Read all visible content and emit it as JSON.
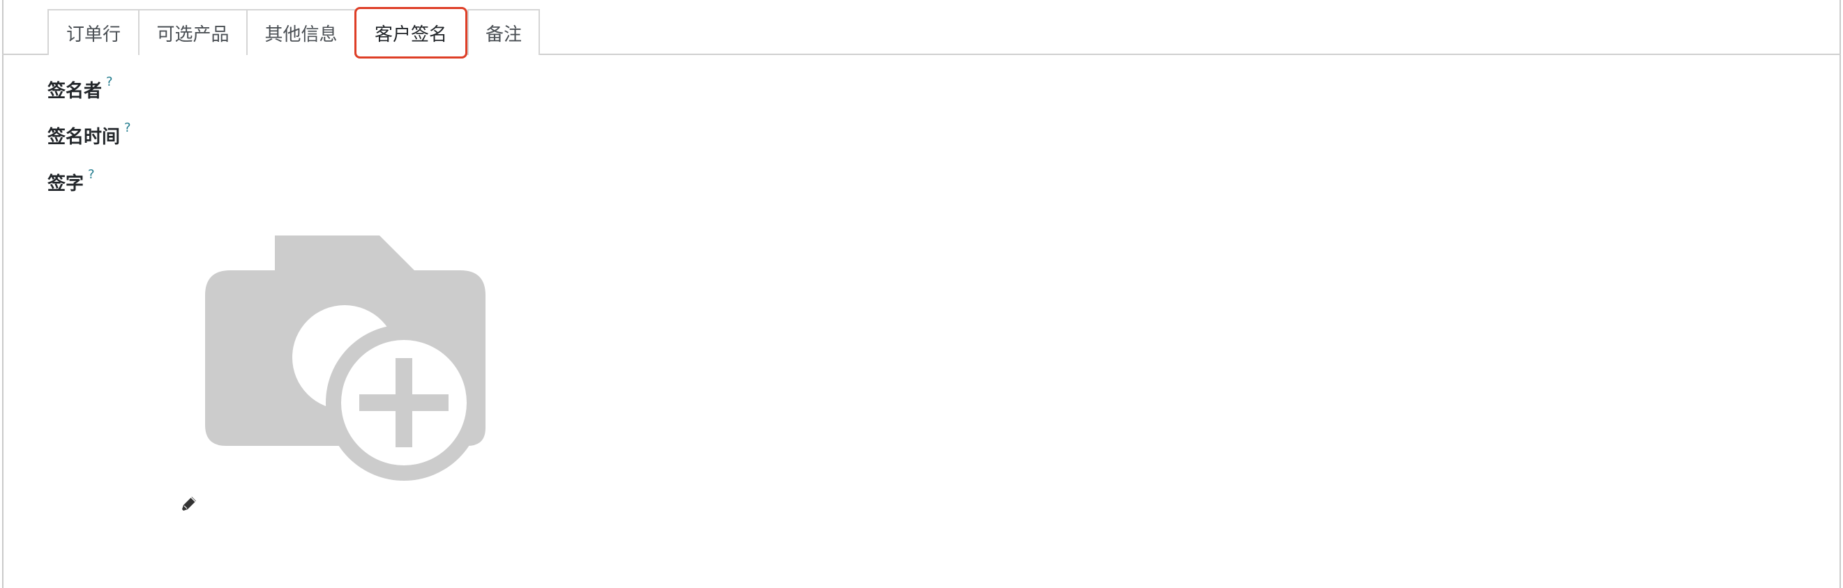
{
  "tabs": [
    {
      "label": "订单行",
      "active": false
    },
    {
      "label": "可选产品",
      "active": false
    },
    {
      "label": "其他信息",
      "active": false
    },
    {
      "label": "客户签名",
      "active": true
    },
    {
      "label": "备注",
      "active": false
    }
  ],
  "fields": {
    "signed_by": {
      "label": "签名者",
      "help": "?"
    },
    "signed_on": {
      "label": "签名时间",
      "help": "?"
    },
    "signature": {
      "label": "签字",
      "help": "?"
    }
  },
  "icons": {
    "placeholder": "camera-plus-icon",
    "edit": "pencil-icon"
  },
  "colors": {
    "active_tab_border": "#de3e26",
    "placeholder_gray": "#cccccc",
    "help_mark": "#1f7a8c"
  }
}
